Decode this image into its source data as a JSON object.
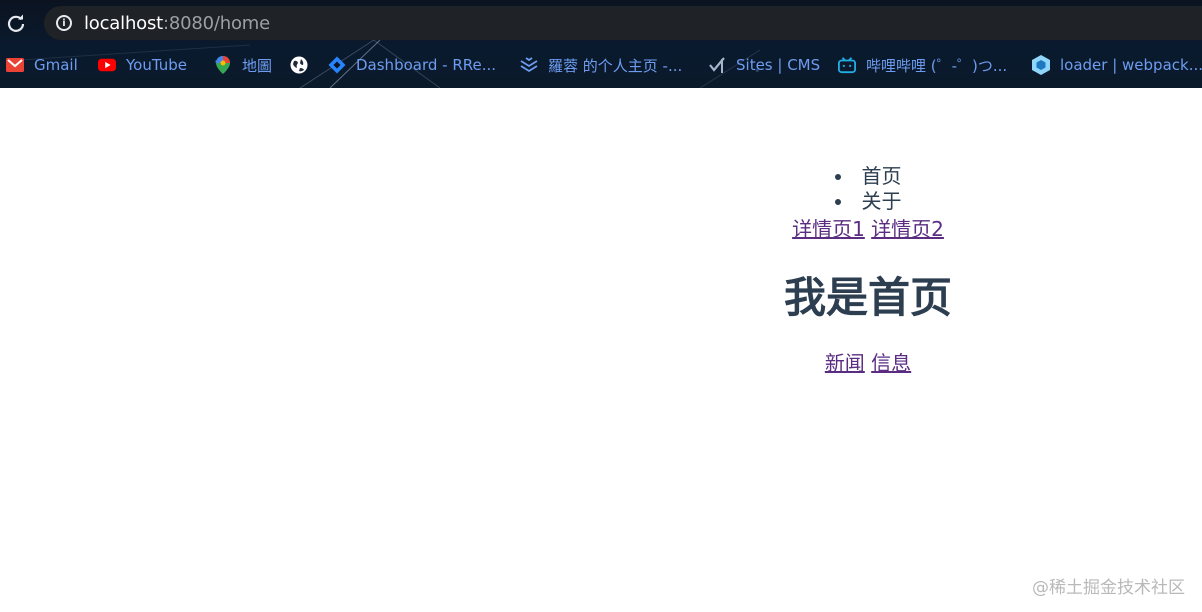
{
  "browser": {
    "url_host": "localhost",
    "url_rest": ":8080/home",
    "bookmarks": [
      {
        "label": "Gmail",
        "icon": "gmail-icon"
      },
      {
        "label": "YouTube",
        "icon": "youtube-icon"
      },
      {
        "label": "地圖",
        "icon": "maps-icon"
      },
      {
        "label": "",
        "icon": "globe-icon"
      },
      {
        "label": "Dashboard - RRe...",
        "icon": "dashboard-icon"
      },
      {
        "label": "羅蓉 的个人主页 -...",
        "icon": "profile-icon"
      },
      {
        "label": "Sites | CMS",
        "icon": "sites-icon"
      },
      {
        "label": "哔哩哔哩 (゜-゜)つ...",
        "icon": "bilibili-icon"
      },
      {
        "label": "loader | webpack...",
        "icon": "webpack-icon"
      }
    ]
  },
  "page": {
    "nav": [
      "首页",
      "关于"
    ],
    "detail_links": [
      "详情页1",
      "详情页2"
    ],
    "title": "我是首页",
    "sub_links": [
      "新闻",
      "信息"
    ]
  },
  "watermark": "@稀土掘金技术社区",
  "colors": {
    "text": "#2c3e50",
    "link_visited": "#5a2c82",
    "bookmark_text": "#6d9cf0"
  }
}
